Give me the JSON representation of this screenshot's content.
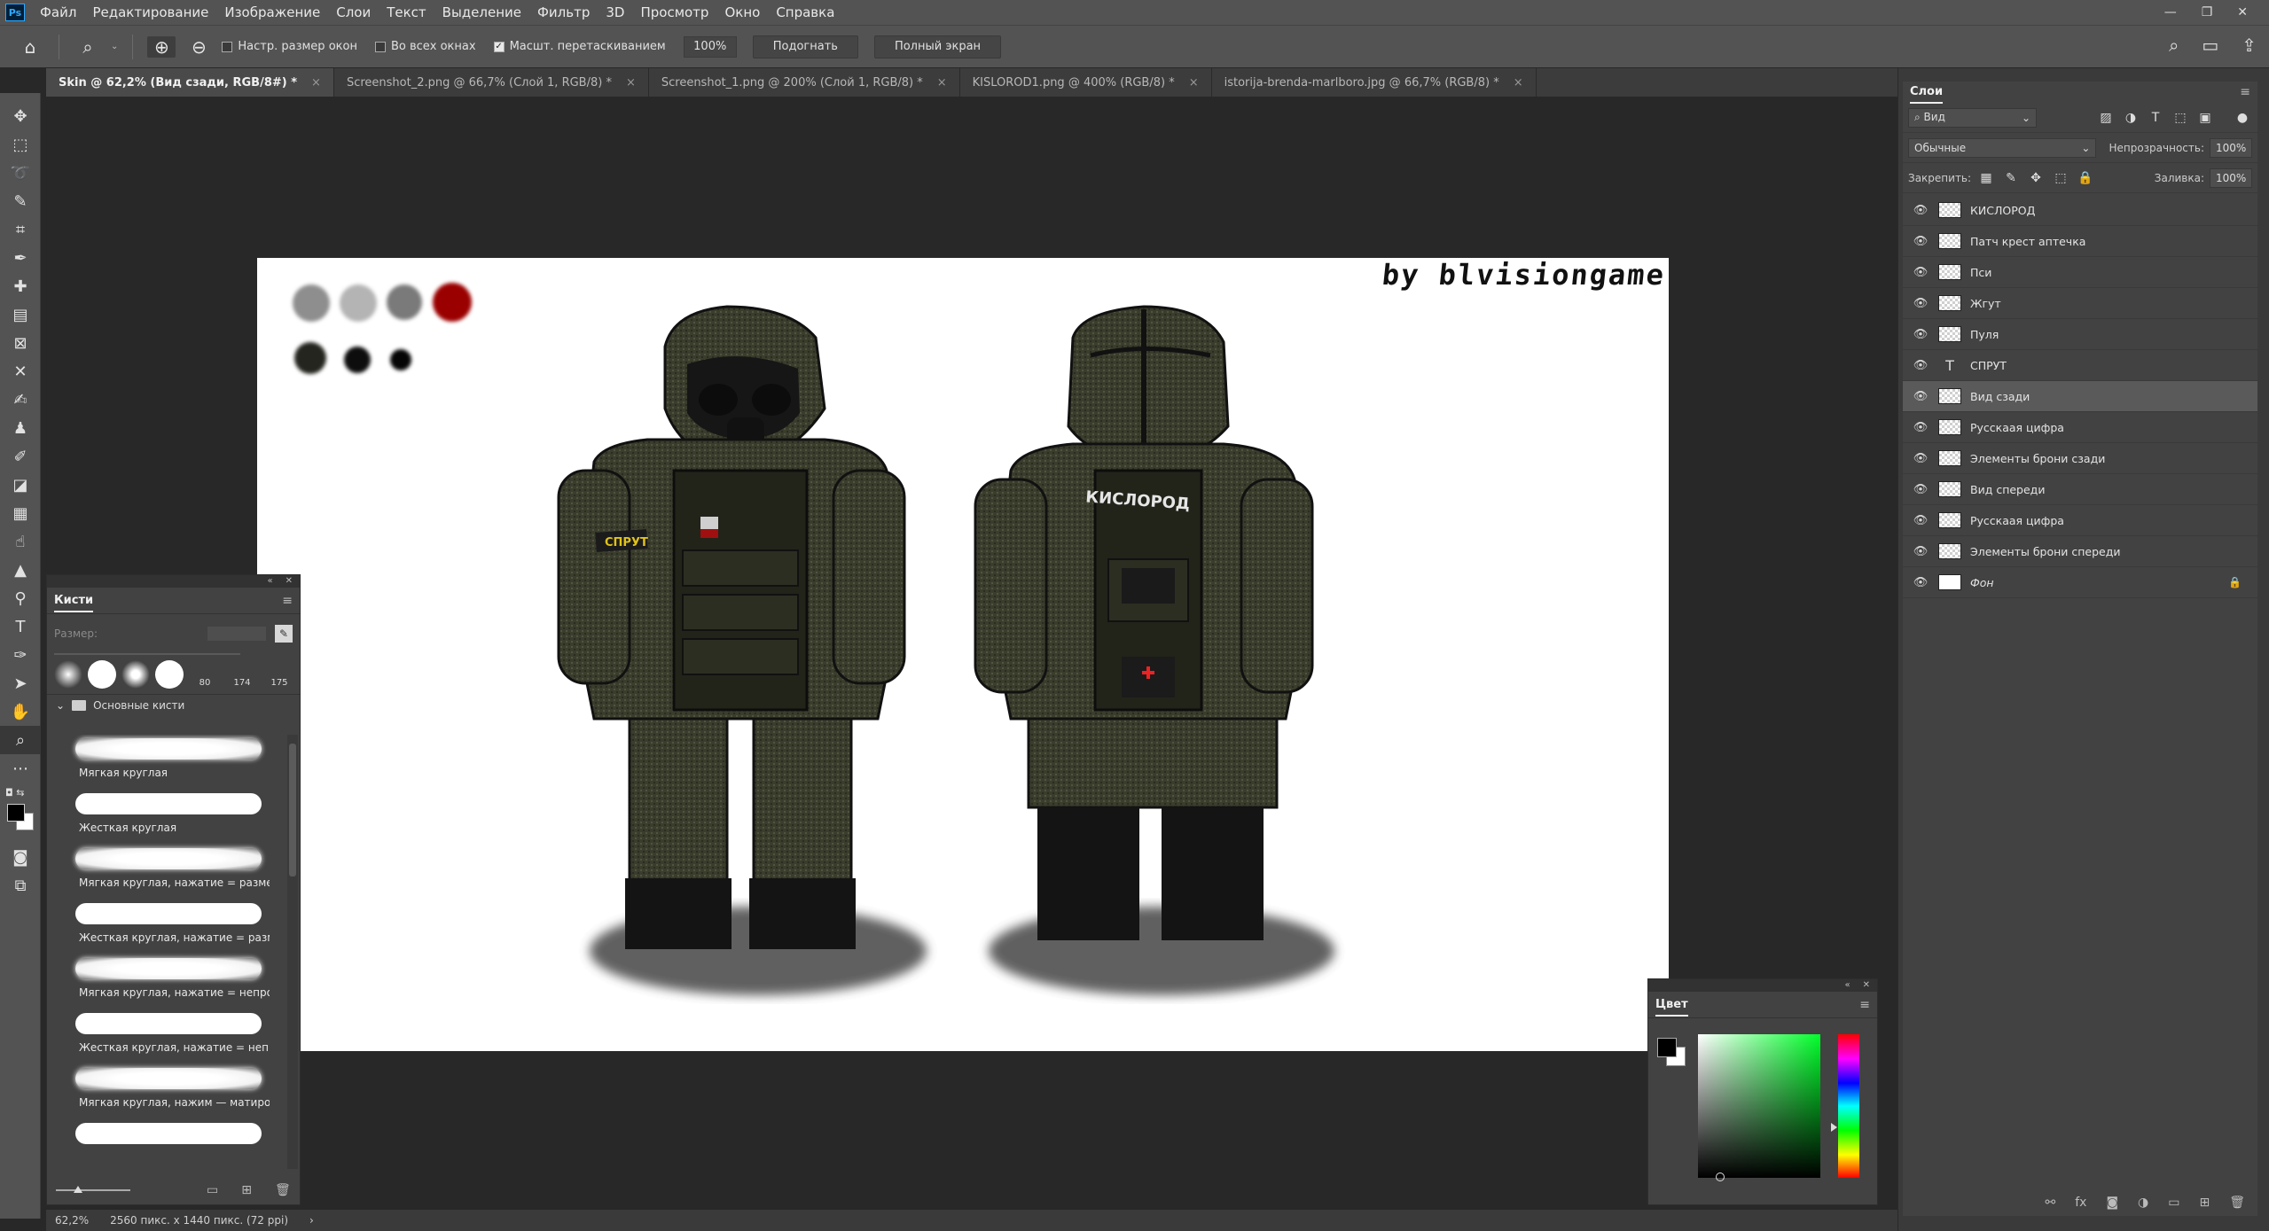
{
  "menu": {
    "logo": "Ps",
    "items": [
      "Файл",
      "Редактирование",
      "Изображение",
      "Слои",
      "Текст",
      "Выделение",
      "Фильтр",
      "3D",
      "Просмотр",
      "Окно",
      "Справка"
    ],
    "window_controls": [
      "—",
      "❐",
      "✕"
    ]
  },
  "options": {
    "resize_windows": "Настр. размер окон",
    "all_windows": "Во всех окнах",
    "scrubby_zoom": "Масшт. перетаскиванием",
    "zoom_value": "100%",
    "fit_button": "Подогнать",
    "fullscreen_button": "Полный экран"
  },
  "tabs": [
    {
      "label": "Skin @ 62,2% (Вид  сзади, RGB/8#) *",
      "close": "×"
    },
    {
      "label": "Screenshot_2.png @ 66,7% (Слой 1, RGB/8) *",
      "close": "×"
    },
    {
      "label": "Screenshot_1.png @ 200% (Слой 1, RGB/8) *",
      "close": "×"
    },
    {
      "label": "KISLOROD1.png @ 400% (RGB/8) *",
      "close": "×"
    },
    {
      "label": "istorija-brenda-marlboro.jpg @ 66,7% (RGB/8) *",
      "close": "×"
    }
  ],
  "canvas": {
    "signature": "by  blvisiongame",
    "armband_text": "СПРУТ",
    "back_text": "КИСЛОРОД",
    "swatch_colors": [
      "#8e8e8e",
      "#b4b4b4",
      "#7a7a7a",
      "#9b0000",
      "#252520",
      "#0d0d0d",
      "#050505"
    ]
  },
  "brushes": {
    "title": "Кисти",
    "size_label": "Размер:",
    "recent_numbers": [
      "80",
      "174",
      "175"
    ],
    "group": "Основные кисти",
    "items": [
      {
        "name": "Мягкая круглая",
        "soft": true
      },
      {
        "name": "Жесткая круглая",
        "soft": false
      },
      {
        "name": "Мягкая круглая, нажатие = размер",
        "soft": true
      },
      {
        "name": "Жесткая круглая, нажатие = разм...",
        "soft": false
      },
      {
        "name": "Мягкая круглая, нажатие = непро...",
        "soft": true
      },
      {
        "name": "Жесткая круглая, нажатие = непр...",
        "soft": false
      },
      {
        "name": "Мягкая круглая, нажим — матиро...",
        "soft": true
      },
      {
        "name": "",
        "soft": false
      }
    ]
  },
  "layers_panel": {
    "title": "Слои",
    "filter": "Вид",
    "blend_mode": "Обычные",
    "opacity_label": "Непрозрачность:",
    "opacity": "100%",
    "lock_label": "Закрепить:",
    "fill_label": "Заливка:",
    "fill": "100%",
    "layers": [
      {
        "name": "КИСЛОРОД",
        "kind": "raster"
      },
      {
        "name": "Патч крест аптечка",
        "kind": "raster"
      },
      {
        "name": "Пси",
        "kind": "raster"
      },
      {
        "name": "Жгут",
        "kind": "raster"
      },
      {
        "name": "Пуля",
        "kind": "raster"
      },
      {
        "name": "СПРУТ",
        "kind": "text"
      },
      {
        "name": "Вид  сзади",
        "kind": "raster",
        "selected": true
      },
      {
        "name": "Русскаая цифра",
        "kind": "raster"
      },
      {
        "name": "Элементы брони сзади",
        "kind": "raster"
      },
      {
        "name": "Вид спереди",
        "kind": "raster"
      },
      {
        "name": "Русскаая цифра",
        "kind": "raster"
      },
      {
        "name": "Элементы брони спереди",
        "kind": "raster"
      },
      {
        "name": "Фон",
        "kind": "background"
      }
    ]
  },
  "color_panel": {
    "title": "Цвет"
  },
  "status": {
    "zoom": "62,2%",
    "doc_info": "2560 пикс. x 1440 пикс. (72 ppi)",
    "arrow": "›"
  }
}
